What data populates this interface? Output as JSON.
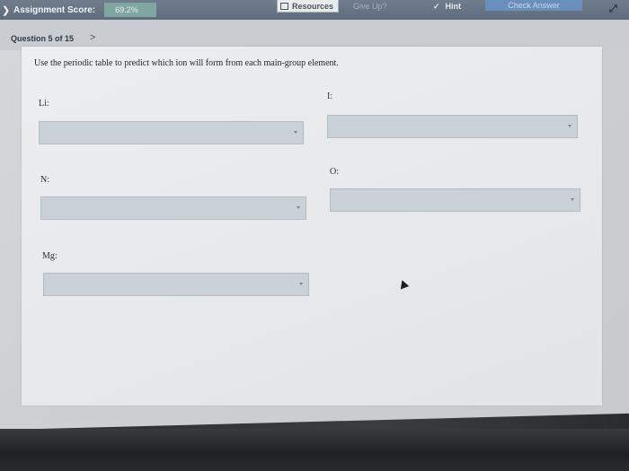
{
  "header": {
    "score_label": "Assignment Score:",
    "score_value": "69.2%",
    "resources_label": "Resources",
    "giveup_label": "Give Up?",
    "hint_label": "Hint",
    "check_label": "Check Answer"
  },
  "nav": {
    "question_label": "Question 5 of 15",
    "next_glyph": ">"
  },
  "question": {
    "prompt": "Use the periodic table to predict which ion will form from each main-group element.",
    "fields": [
      {
        "label": "Li:",
        "value": ""
      },
      {
        "label": "I:",
        "value": ""
      },
      {
        "label": "N:",
        "value": ""
      },
      {
        "label": "O:",
        "value": ""
      },
      {
        "label": "Mg:",
        "value": ""
      }
    ]
  },
  "colors": {
    "topbar": "#6f7d8c",
    "score_badge": "#7fa6a1",
    "check_answer": "#6b8fbd",
    "select_fill": "#c9d2d6"
  }
}
